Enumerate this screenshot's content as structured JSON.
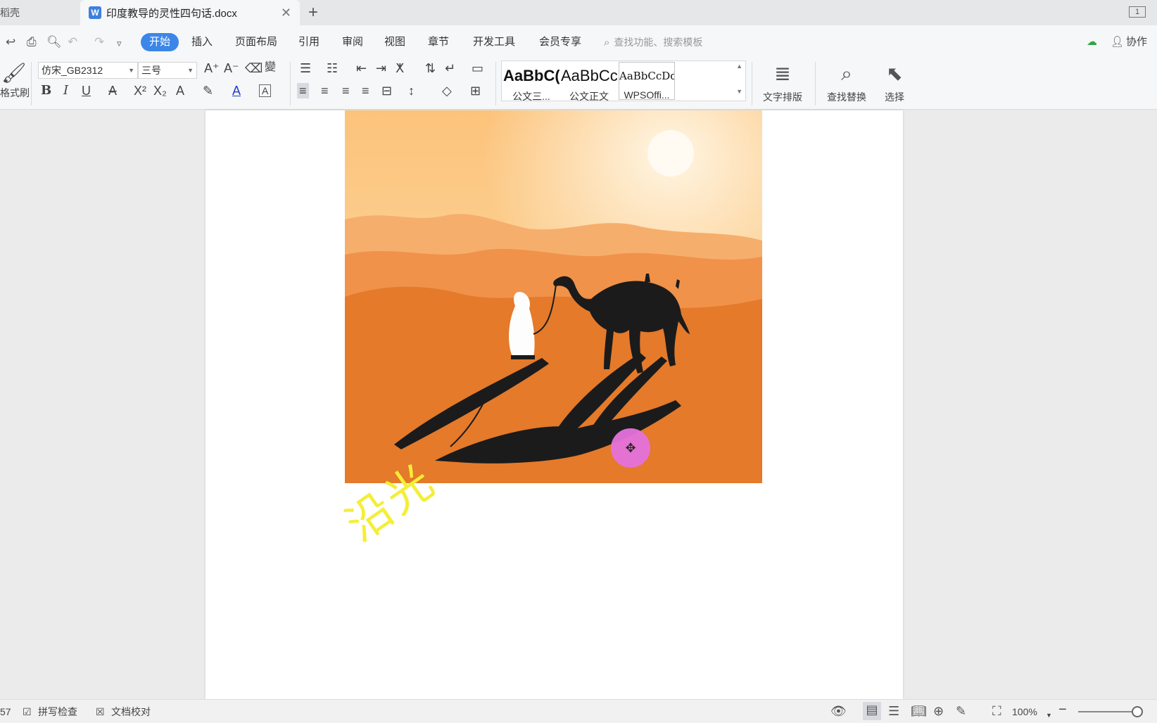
{
  "tabs": {
    "previous_label": "稻壳",
    "active_title": "印度教导的灵性四句话.docx",
    "logo_glyph": "W",
    "window_mode": "1"
  },
  "menu": {
    "items": [
      "开始",
      "插入",
      "页面布局",
      "引用",
      "审阅",
      "视图",
      "章节",
      "开发工具",
      "会员专享"
    ],
    "search_placeholder": "查找功能、搜索模板",
    "collab_label": "协作"
  },
  "ribbon": {
    "format_painter_label": "格式刷",
    "font_name": "仿宋_GB2312",
    "font_size": "三号",
    "styles": [
      {
        "sample": "AaBbC(",
        "name": "公文三..."
      },
      {
        "sample": "AaBbCc",
        "name": "公文正文"
      },
      {
        "sample": "AaBbCcDd",
        "name": "WPSOffi..."
      }
    ],
    "text_layout_label": "文字排版",
    "find_replace_label": "查找替换",
    "select_label": "选择"
  },
  "document": {
    "watermark_text": "沿光",
    "accent_color": "#3c86e8",
    "cursor_color": "#e572dc"
  },
  "status": {
    "page_num_fragment": "57",
    "spellcheck_label": "拼写检查",
    "proofread_label": "文档校对",
    "zoom": "100%"
  }
}
